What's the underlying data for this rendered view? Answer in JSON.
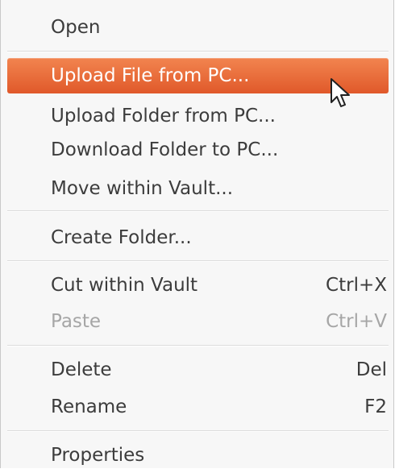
{
  "menu": {
    "items": [
      {
        "label": "Open",
        "shortcut": "",
        "state": "normal"
      },
      {
        "label": "Upload File from PC...",
        "shortcut": "",
        "state": "highlighted"
      },
      {
        "label": "Upload Folder from PC...",
        "shortcut": "",
        "state": "normal"
      },
      {
        "label": "Download Folder to PC...",
        "shortcut": "",
        "state": "normal"
      },
      {
        "label": "Move within Vault...",
        "shortcut": "",
        "state": "normal"
      },
      {
        "label": "Create Folder...",
        "shortcut": "",
        "state": "normal"
      },
      {
        "label": "Cut within Vault",
        "shortcut": "Ctrl+X",
        "state": "normal"
      },
      {
        "label": "Paste",
        "shortcut": "Ctrl+V",
        "state": "disabled"
      },
      {
        "label": "Delete",
        "shortcut": "Del",
        "state": "normal"
      },
      {
        "label": "Rename",
        "shortcut": "F2",
        "state": "normal"
      },
      {
        "label": "Properties",
        "shortcut": "",
        "state": "normal"
      }
    ]
  },
  "colors": {
    "highlight": "#e8663a",
    "text": "#3c3c3c",
    "disabled_text": "#a6a6a6",
    "background": "#f7f7f7"
  },
  "icons": {
    "cursor": "mouse-pointer-icon"
  }
}
